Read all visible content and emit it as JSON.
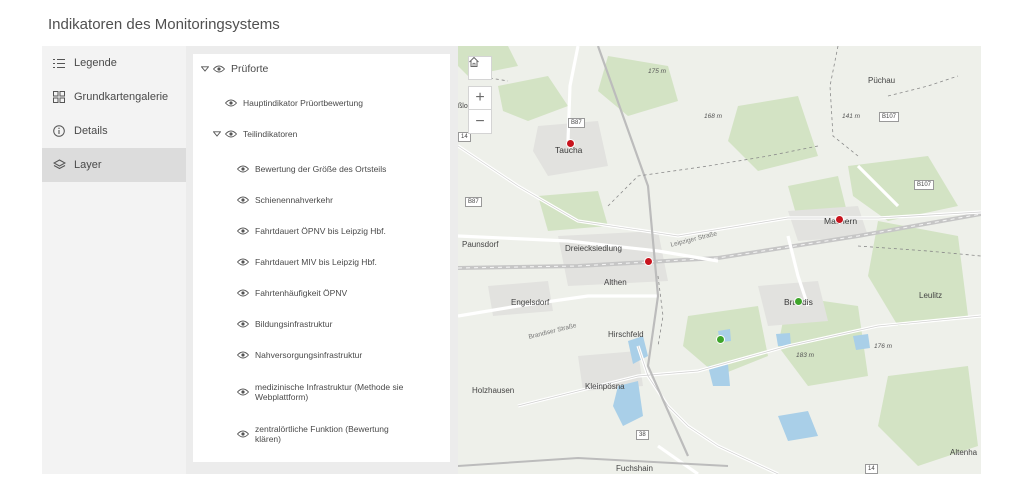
{
  "app": {
    "title": "Indikatoren des Monitoringsystems"
  },
  "sidebar": {
    "items": [
      {
        "label": "Legende",
        "icon": "legend-icon",
        "active": false
      },
      {
        "label": "Grundkartengalerie",
        "icon": "basemap-gallery-icon",
        "active": false
      },
      {
        "label": "Details",
        "icon": "info-icon",
        "active": false
      },
      {
        "label": "Layer",
        "icon": "layers-icon",
        "active": true
      }
    ]
  },
  "layers": {
    "group": "Prüforte",
    "main_indicator": "Hauptindikator Prüortbewertung",
    "sub_group": "Teilindikatoren",
    "sub_items": [
      "Bewertung der Größe des Ortsteils",
      "Schienennahverkehr",
      "Fahrtdauert ÖPNV bis Leipzig Hbf.",
      "Fahrtdauert MIV bis Leipzig Hbf.",
      "Fahrtenhäufigkeit ÖPNV",
      "Bildungsinfrastruktur",
      "Nahversorgungsinfrastruktur",
      "medizinische Infrastruktur (Methode sie Webplattform)",
      "zentralörtliche Funktion (Bewertung klären)"
    ]
  },
  "map": {
    "places": {
      "taucha": "Taucha",
      "machern": "Machern",
      "paunsdorf": "Paunsdorf",
      "dreiecksiedlung": "Dreiecksiedlung",
      "althen": "Althen",
      "engelsdorf": "Engelsdorf",
      "brandis": "Brandis",
      "leulitz": "Leulitz",
      "hirschfeld": "Hirschfeld",
      "holzhausen": "Holzhausen",
      "kleinposna": "Kleinpösna",
      "puchau": "Püchau",
      "fuchshain": "Fuchshain",
      "altenhain": "Altenha",
      "plositz": "ßlo   itz"
    },
    "streets": {
      "leipziger": "Leipziger Straße",
      "brandiser": "Brandiser Straße"
    },
    "elevations": [
      "175 m",
      "168 m",
      "141 m",
      "183 m",
      "176 m"
    ],
    "roads": [
      "B87",
      "B87",
      "B107",
      "B107",
      "14",
      "14",
      "38"
    ],
    "status_colors": {
      "red": "#c8141e",
      "green": "#3ea52a"
    },
    "controls": {
      "home": "home-icon",
      "zoom_in": "+",
      "zoom_out": "−"
    }
  }
}
